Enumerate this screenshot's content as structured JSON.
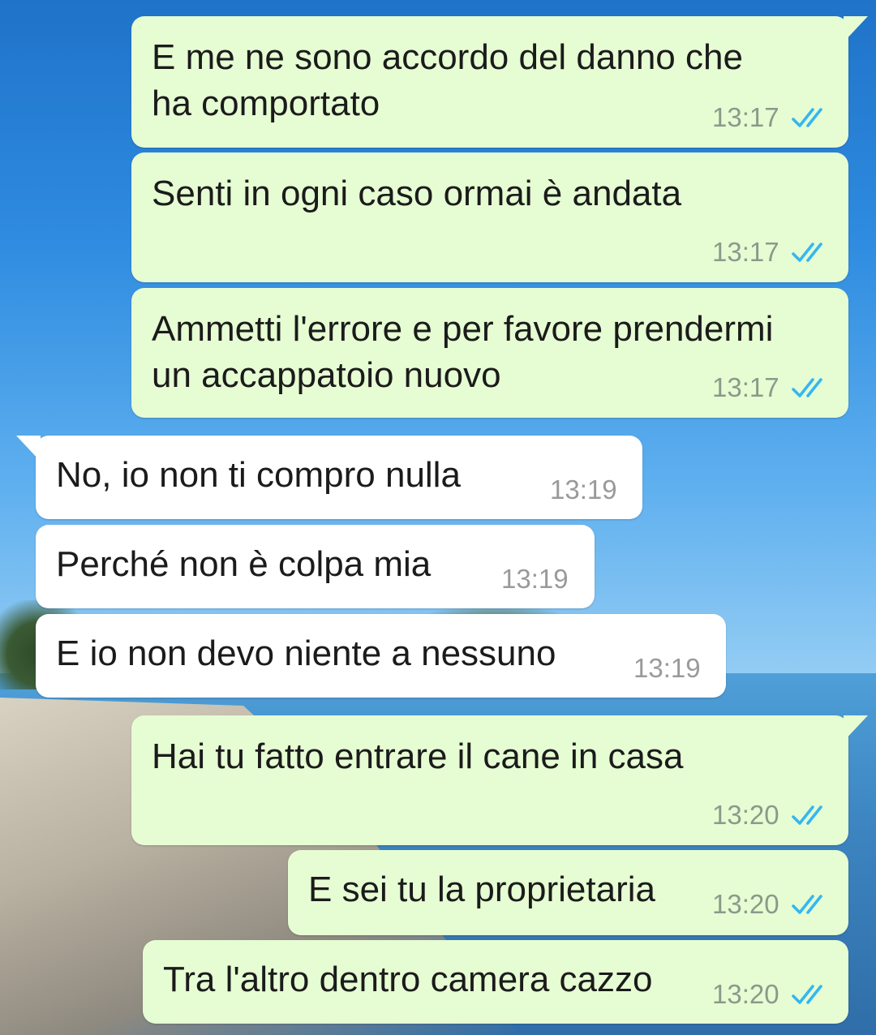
{
  "colors": {
    "outgoing_bubble": "#e6fdd3",
    "incoming_bubble": "#ffffff",
    "read_ticks": "#34b7f1"
  },
  "messages": [
    {
      "direction": "outgoing",
      "lines": [
        "E me ne sono accordo del danno che",
        "ha comportato"
      ],
      "time": "13:17",
      "status": "read-double-tick-icon"
    },
    {
      "direction": "outgoing",
      "lines": [
        "Senti in ogni caso ormai è andata"
      ],
      "time": "13:17",
      "status": "read-double-tick-icon"
    },
    {
      "direction": "outgoing",
      "lines": [
        "Ammetti l'errore e per favore prendermi",
        "un accappatoio nuovo"
      ],
      "time": "13:17",
      "status": "read-double-tick-icon"
    },
    {
      "direction": "incoming",
      "lines": [
        "No, io non ti compro nulla"
      ],
      "time": "13:19"
    },
    {
      "direction": "incoming",
      "lines": [
        "Perché non è colpa mia"
      ],
      "time": "13:19"
    },
    {
      "direction": "incoming",
      "lines": [
        "E io non devo niente a nessuno"
      ],
      "time": "13:19"
    },
    {
      "direction": "outgoing",
      "lines": [
        "Hai tu fatto entrare il cane in casa"
      ],
      "time": "13:20",
      "status": "read-double-tick-icon"
    },
    {
      "direction": "outgoing",
      "lines": [
        "E sei tu la proprietaria"
      ],
      "time": "13:20",
      "status": "read-double-tick-icon"
    },
    {
      "direction": "outgoing",
      "lines": [
        "Tra l'altro dentro camera cazzo"
      ],
      "time": "13:20",
      "status": "read-double-tick-icon"
    }
  ]
}
